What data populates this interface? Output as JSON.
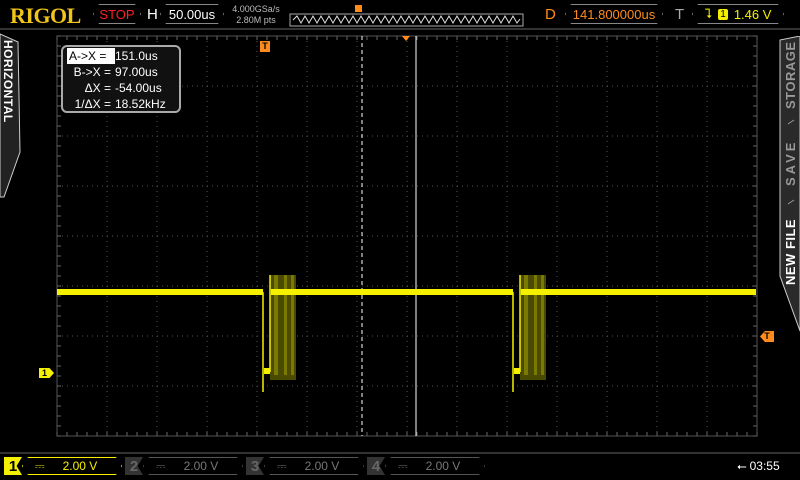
{
  "header": {
    "brand": "RIGOL",
    "run_state": "STOP",
    "h_label": "H",
    "timebase": "50.00us",
    "sample_rate": "4.000GSa/s",
    "memory_depth": "2.80M pts",
    "d_label": "D",
    "delay": "141.800000us",
    "t_label": "T",
    "trigger_channel": "1",
    "trigger_level": "1.46 V"
  },
  "left_menu": {
    "label": "HORIZONTAL"
  },
  "right_menu": {
    "items": [
      "STORAGE",
      "SAVE",
      "NEW FILE"
    ]
  },
  "cursor_readout": {
    "rows": [
      {
        "key": "A->X =",
        "value": "151.0us"
      },
      {
        "key": "B->X =",
        "value": "97.00us"
      },
      {
        "key": "ΔX =",
        "value": "-54.00us"
      },
      {
        "key": "1/ΔX =",
        "value": "18.52kHz"
      }
    ]
  },
  "markers": {
    "trigger": "T",
    "channel1": "1"
  },
  "channels": [
    {
      "num": "1",
      "coupling": "⎓",
      "scale": "2.00 V",
      "active": true
    },
    {
      "num": "2",
      "coupling": "⎓",
      "scale": "2.00 V",
      "active": false
    },
    {
      "num": "3",
      "coupling": "⎓",
      "scale": "2.00 V",
      "active": false
    },
    {
      "num": "4",
      "coupling": "⎓",
      "scale": "2.00 V",
      "active": false
    }
  ],
  "status": {
    "time": "03:55",
    "usb_icon": "usb-icon"
  },
  "colors": {
    "trace": "#f5f000",
    "accent": "#ff8c1a",
    "stop": "#ff2020"
  }
}
